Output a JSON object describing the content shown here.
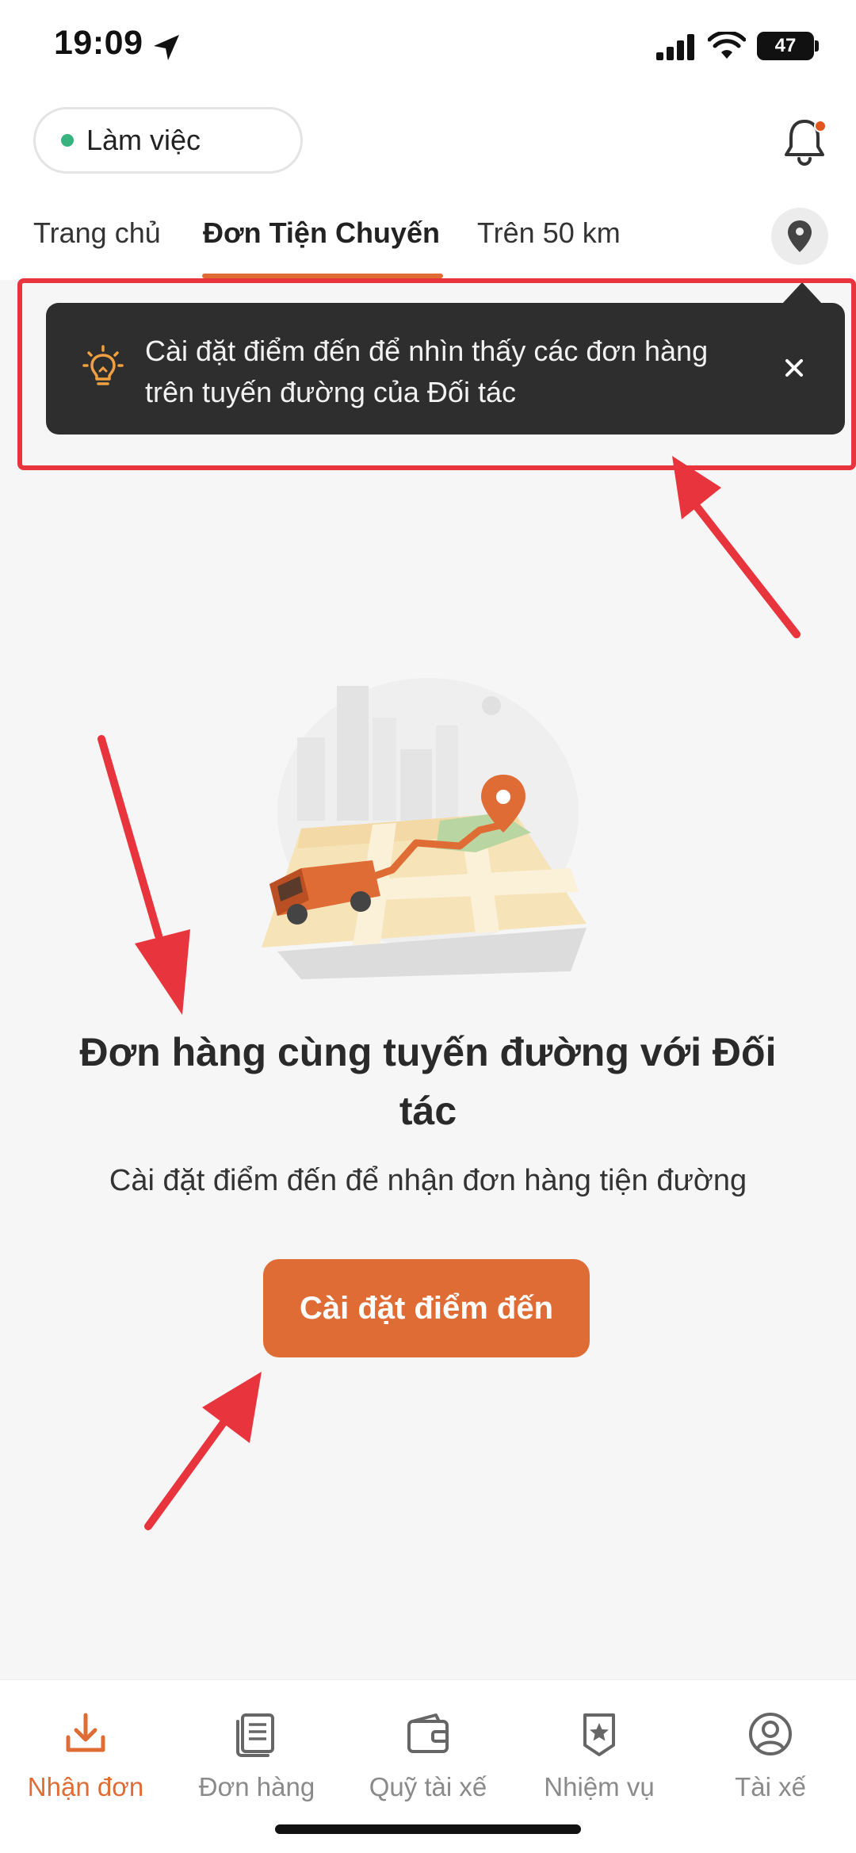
{
  "status_bar": {
    "time": "19:09",
    "battery": "47"
  },
  "header": {
    "status_label": "Làm việc"
  },
  "tabs": [
    {
      "label": "Trang chủ"
    },
    {
      "label": "Đơn Tiện Chuyến"
    },
    {
      "label": "Trên 50 km"
    }
  ],
  "tooltip": {
    "text": "Cài đặt điểm đến để nhìn thấy các đơn hàng trên tuyến đường của Đối tác",
    "close": "×"
  },
  "empty_state": {
    "title": "Đơn hàng cùng tuyến đường với Đối tác",
    "subtitle": "Cài đặt điểm đến để nhận đơn hàng tiện đường",
    "button": "Cài đặt điểm đến"
  },
  "bottom_nav": [
    {
      "label": "Nhận đơn",
      "icon": "download-icon",
      "active": true
    },
    {
      "label": "Đơn hàng",
      "icon": "orders-icon"
    },
    {
      "label": "Quỹ tài xế",
      "icon": "wallet-icon"
    },
    {
      "label": "Nhiệm vụ",
      "icon": "badge-star-icon"
    },
    {
      "label": "Tài xế",
      "icon": "profile-icon"
    }
  ],
  "colors": {
    "accent": "#e06c35",
    "tooltip_bg": "#2e2e2e",
    "annotation": "#e8343c",
    "online": "#36b37e"
  }
}
